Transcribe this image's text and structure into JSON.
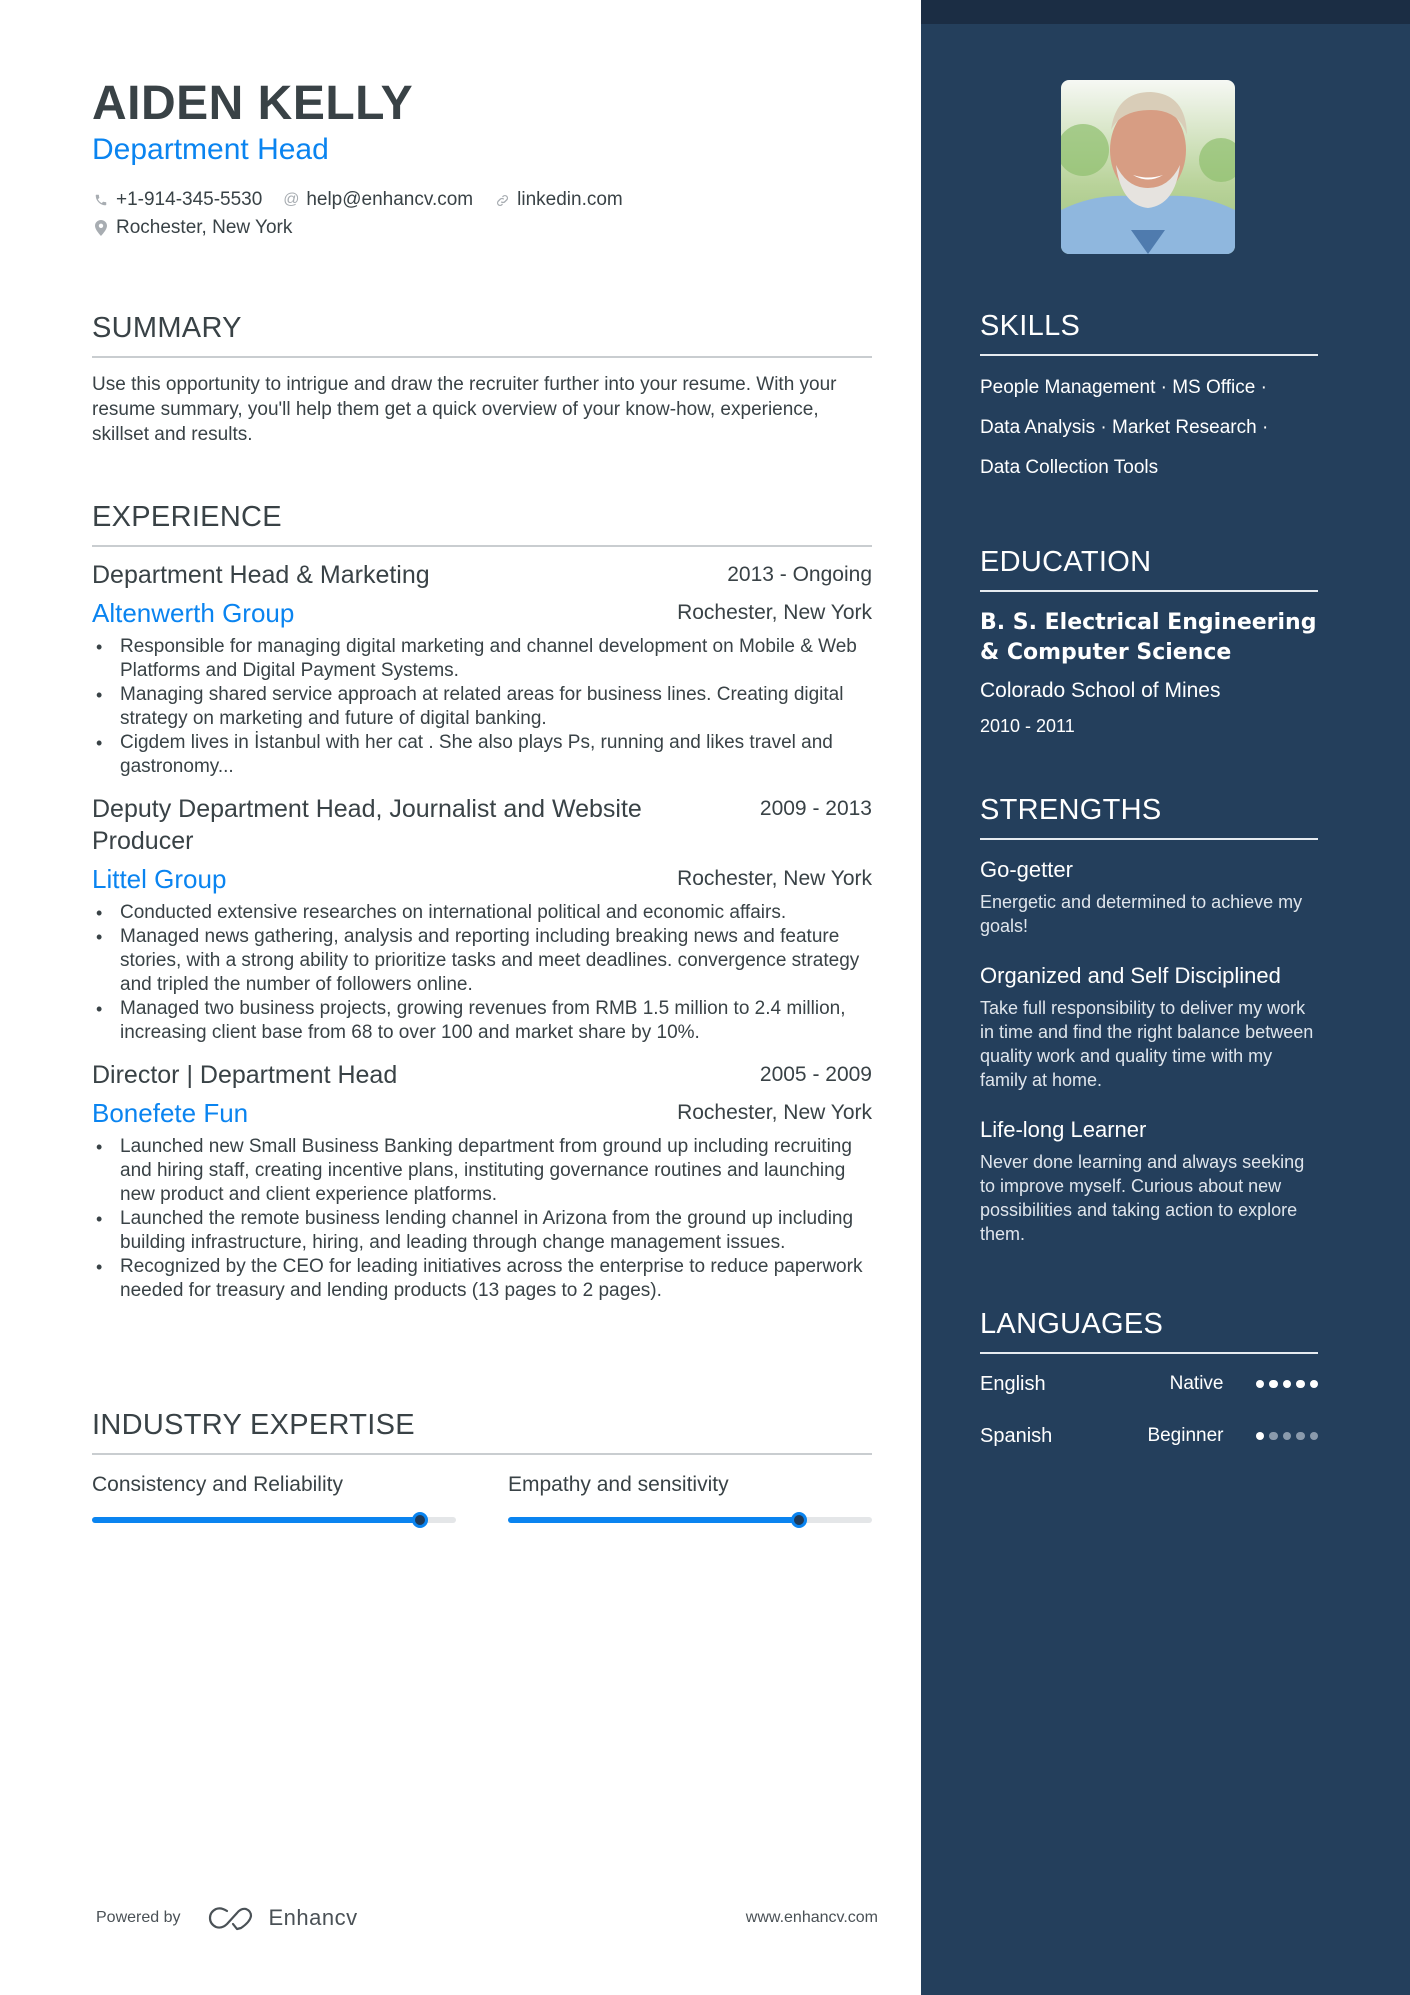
{
  "header": {
    "name": "AIDEN KELLY",
    "title": "Department Head",
    "contacts": [
      {
        "icon": "phone-icon",
        "glyph": "✆",
        "text": "+1-914-345-5530"
      },
      {
        "icon": "at-icon",
        "glyph": "@",
        "text": "help@enhancv.com"
      },
      {
        "icon": "link-icon",
        "glyph": "🔗",
        "text": "linkedin.com"
      }
    ],
    "location": {
      "icon": "location-pin-icon",
      "text": "Rochester, New York"
    }
  },
  "summary": {
    "heading": "SUMMARY",
    "text": "Use this opportunity to intrigue and draw the recruiter further into your resume. With your resume summary, you'll help them get a quick overview of your know-how, experience, skillset and results."
  },
  "experience": {
    "heading": "EXPERIENCE",
    "jobs": [
      {
        "title": "Department Head & Marketing",
        "dates": "2013 - Ongoing",
        "company": "Altenwerth Group",
        "location": "Rochester, New York",
        "bullets": [
          "Responsible for managing digital marketing and channel development on Mobile & Web Platforms and Digital Payment Systems.",
          "Managing shared service approach at related areas for business lines. Creating digital strategy on marketing and future of digital banking.",
          "Cigdem lives in İstanbul with her cat . She also plays Ps, running and likes travel and gastronomy..."
        ]
      },
      {
        "title": "Deputy Department Head, Journalist and Website Producer",
        "dates": "2009 - 2013",
        "company": "Littel Group",
        "location": "Rochester, New York",
        "bullets": [
          "Conducted extensive researches on international political and economic affairs.",
          "Managed news gathering, analysis and reporting including breaking news and feature stories, with a strong ability to prioritize tasks and meet deadlines. convergence strategy and tripled the number of followers online.",
          "Managed two business projects, growing revenues from RMB 1.5 million to 2.4 million, increasing client base from 68 to over 100 and market share by 10%."
        ]
      },
      {
        "title": "Director | Department Head",
        "dates": "2005 - 2009",
        "company": "Bonefete Fun",
        "location": "Rochester, New York",
        "bullets": [
          "Launched new Small Business Banking department from ground up including recruiting and hiring staff, creating incentive plans, instituting governance routines and launching new product and client experience platforms.",
          "Launched the remote business lending channel in Arizona from the ground up including building infrastructure, hiring, and leading through change management issues.",
          "Recognized by the CEO for leading initiatives across the enterprise to reduce paperwork needed for treasury and lending products (13 pages to 2 pages)."
        ]
      }
    ]
  },
  "industry_expertise": {
    "heading": "INDUSTRY EXPERTISE",
    "items": [
      {
        "label": "Consistency and Reliability",
        "level": 0.9
      },
      {
        "label": "Empathy and sensitivity",
        "level": 0.8
      }
    ]
  },
  "sidebar": {
    "skills": {
      "heading": "SKILLS",
      "lines": [
        "People Management · MS Office ·",
        "Data Analysis · Market Research ·",
        "Data Collection Tools"
      ]
    },
    "education": {
      "heading": "EDUCATION",
      "degree": "B. S. Electrical Engineering & Computer Science",
      "school": "Colorado School of Mines",
      "dates": "2010 - 2011"
    },
    "strengths": {
      "heading": "STRENGTHS",
      "items": [
        {
          "title": "Go-getter",
          "desc": "Energetic and determined to achieve my goals!"
        },
        {
          "title": "Organized and Self Disciplined",
          "desc": "Take full responsibility to deliver my work in time and find the right balance between quality work and quality time with my family at home."
        },
        {
          "title": "Life-long Learner",
          "desc": "Never done learning and always seeking to improve myself. Curious about new possibilities and taking action to explore them."
        }
      ]
    },
    "languages": {
      "heading": "LANGUAGES",
      "items": [
        {
          "name": "English",
          "level": "Native",
          "dots": 5,
          "max": 5
        },
        {
          "name": "Spanish",
          "level": "Beginner",
          "dots": 1,
          "max": 5
        }
      ]
    }
  },
  "footer": {
    "powered_by": "Powered by",
    "brand": "Enhancv",
    "website": "www.enhancv.com"
  },
  "colors": {
    "accent": "#0a84f0",
    "sidebar": "#243f5c",
    "sidebar_top": "#1b2d44",
    "text": "#394246"
  }
}
